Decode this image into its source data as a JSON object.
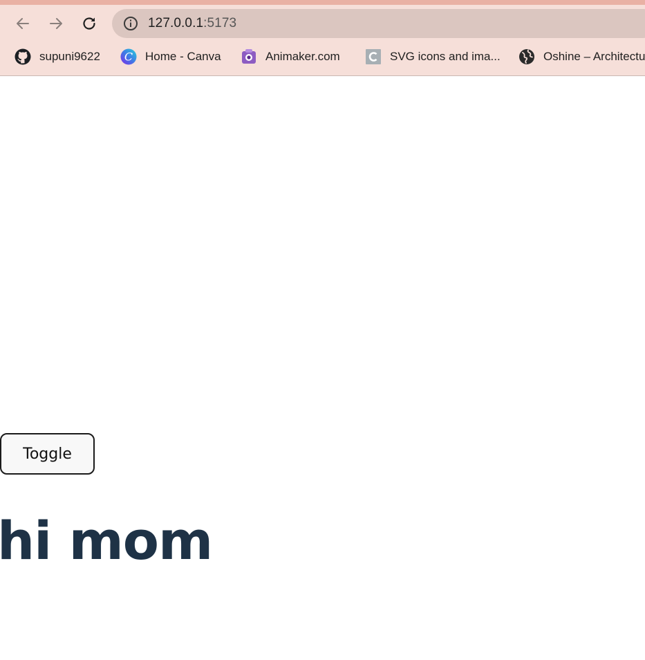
{
  "browser": {
    "url_host": "127.0.0.1",
    "url_port": ":5173",
    "bookmarks": [
      {
        "label": "supuni9622",
        "icon": "github-icon"
      },
      {
        "label": "Home - Canva",
        "icon": "canva-icon"
      },
      {
        "label": "Animaker.com",
        "icon": "animaker-icon"
      },
      {
        "label": "SVG icons and ima...",
        "icon": "svg-site-icon"
      },
      {
        "label": "Oshine – Architectu",
        "icon": "globe-icon"
      }
    ]
  },
  "page": {
    "toggle_label": "Toggle",
    "heading": "hi mom"
  },
  "colors": {
    "chrome_bg": "#f6dfd9",
    "address_bar_bg": "#dbc6c0",
    "heading_color": "#1e3246"
  }
}
